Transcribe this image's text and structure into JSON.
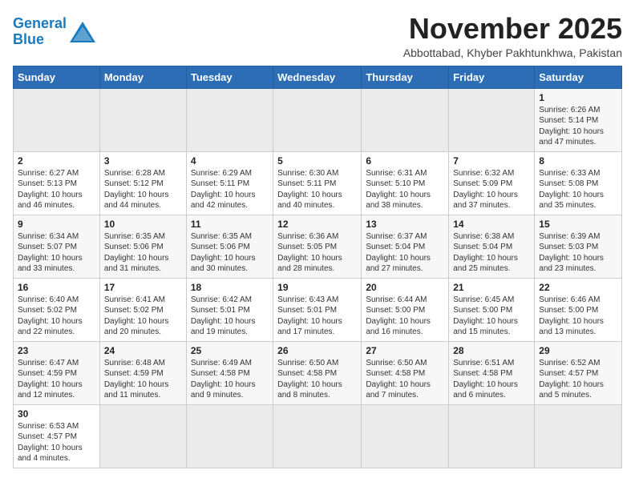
{
  "header": {
    "logo_general": "General",
    "logo_blue": "Blue",
    "month_title": "November 2025",
    "subtitle": "Abbottabad, Khyber Pakhtunkhwa, Pakistan"
  },
  "weekdays": [
    "Sunday",
    "Monday",
    "Tuesday",
    "Wednesday",
    "Thursday",
    "Friday",
    "Saturday"
  ],
  "weeks": [
    [
      {
        "day": "",
        "empty": true
      },
      {
        "day": "",
        "empty": true
      },
      {
        "day": "",
        "empty": true
      },
      {
        "day": "",
        "empty": true
      },
      {
        "day": "",
        "empty": true
      },
      {
        "day": "",
        "empty": true
      },
      {
        "day": "1",
        "sunrise": "6:26 AM",
        "sunset": "5:14 PM",
        "daylight": "10 hours and 47 minutes."
      }
    ],
    [
      {
        "day": "2",
        "sunrise": "6:27 AM",
        "sunset": "5:13 PM",
        "daylight": "10 hours and 46 minutes."
      },
      {
        "day": "3",
        "sunrise": "6:28 AM",
        "sunset": "5:12 PM",
        "daylight": "10 hours and 44 minutes."
      },
      {
        "day": "4",
        "sunrise": "6:29 AM",
        "sunset": "5:11 PM",
        "daylight": "10 hours and 42 minutes."
      },
      {
        "day": "5",
        "sunrise": "6:30 AM",
        "sunset": "5:11 PM",
        "daylight": "10 hours and 40 minutes."
      },
      {
        "day": "6",
        "sunrise": "6:31 AM",
        "sunset": "5:10 PM",
        "daylight": "10 hours and 38 minutes."
      },
      {
        "day": "7",
        "sunrise": "6:32 AM",
        "sunset": "5:09 PM",
        "daylight": "10 hours and 37 minutes."
      },
      {
        "day": "8",
        "sunrise": "6:33 AM",
        "sunset": "5:08 PM",
        "daylight": "10 hours and 35 minutes."
      }
    ],
    [
      {
        "day": "9",
        "sunrise": "6:34 AM",
        "sunset": "5:07 PM",
        "daylight": "10 hours and 33 minutes."
      },
      {
        "day": "10",
        "sunrise": "6:35 AM",
        "sunset": "5:06 PM",
        "daylight": "10 hours and 31 minutes."
      },
      {
        "day": "11",
        "sunrise": "6:35 AM",
        "sunset": "5:06 PM",
        "daylight": "10 hours and 30 minutes."
      },
      {
        "day": "12",
        "sunrise": "6:36 AM",
        "sunset": "5:05 PM",
        "daylight": "10 hours and 28 minutes."
      },
      {
        "day": "13",
        "sunrise": "6:37 AM",
        "sunset": "5:04 PM",
        "daylight": "10 hours and 27 minutes."
      },
      {
        "day": "14",
        "sunrise": "6:38 AM",
        "sunset": "5:04 PM",
        "daylight": "10 hours and 25 minutes."
      },
      {
        "day": "15",
        "sunrise": "6:39 AM",
        "sunset": "5:03 PM",
        "daylight": "10 hours and 23 minutes."
      }
    ],
    [
      {
        "day": "16",
        "sunrise": "6:40 AM",
        "sunset": "5:02 PM",
        "daylight": "10 hours and 22 minutes."
      },
      {
        "day": "17",
        "sunrise": "6:41 AM",
        "sunset": "5:02 PM",
        "daylight": "10 hours and 20 minutes."
      },
      {
        "day": "18",
        "sunrise": "6:42 AM",
        "sunset": "5:01 PM",
        "daylight": "10 hours and 19 minutes."
      },
      {
        "day": "19",
        "sunrise": "6:43 AM",
        "sunset": "5:01 PM",
        "daylight": "10 hours and 17 minutes."
      },
      {
        "day": "20",
        "sunrise": "6:44 AM",
        "sunset": "5:00 PM",
        "daylight": "10 hours and 16 minutes."
      },
      {
        "day": "21",
        "sunrise": "6:45 AM",
        "sunset": "5:00 PM",
        "daylight": "10 hours and 15 minutes."
      },
      {
        "day": "22",
        "sunrise": "6:46 AM",
        "sunset": "5:00 PM",
        "daylight": "10 hours and 13 minutes."
      }
    ],
    [
      {
        "day": "23",
        "sunrise": "6:47 AM",
        "sunset": "4:59 PM",
        "daylight": "10 hours and 12 minutes."
      },
      {
        "day": "24",
        "sunrise": "6:48 AM",
        "sunset": "4:59 PM",
        "daylight": "10 hours and 11 minutes."
      },
      {
        "day": "25",
        "sunrise": "6:49 AM",
        "sunset": "4:58 PM",
        "daylight": "10 hours and 9 minutes."
      },
      {
        "day": "26",
        "sunrise": "6:50 AM",
        "sunset": "4:58 PM",
        "daylight": "10 hours and 8 minutes."
      },
      {
        "day": "27",
        "sunrise": "6:50 AM",
        "sunset": "4:58 PM",
        "daylight": "10 hours and 7 minutes."
      },
      {
        "day": "28",
        "sunrise": "6:51 AM",
        "sunset": "4:58 PM",
        "daylight": "10 hours and 6 minutes."
      },
      {
        "day": "29",
        "sunrise": "6:52 AM",
        "sunset": "4:57 PM",
        "daylight": "10 hours and 5 minutes."
      }
    ],
    [
      {
        "day": "30",
        "sunrise": "6:53 AM",
        "sunset": "4:57 PM",
        "daylight": "10 hours and 4 minutes."
      },
      {
        "day": "",
        "empty": true
      },
      {
        "day": "",
        "empty": true
      },
      {
        "day": "",
        "empty": true
      },
      {
        "day": "",
        "empty": true
      },
      {
        "day": "",
        "empty": true
      },
      {
        "day": "",
        "empty": true
      }
    ]
  ]
}
